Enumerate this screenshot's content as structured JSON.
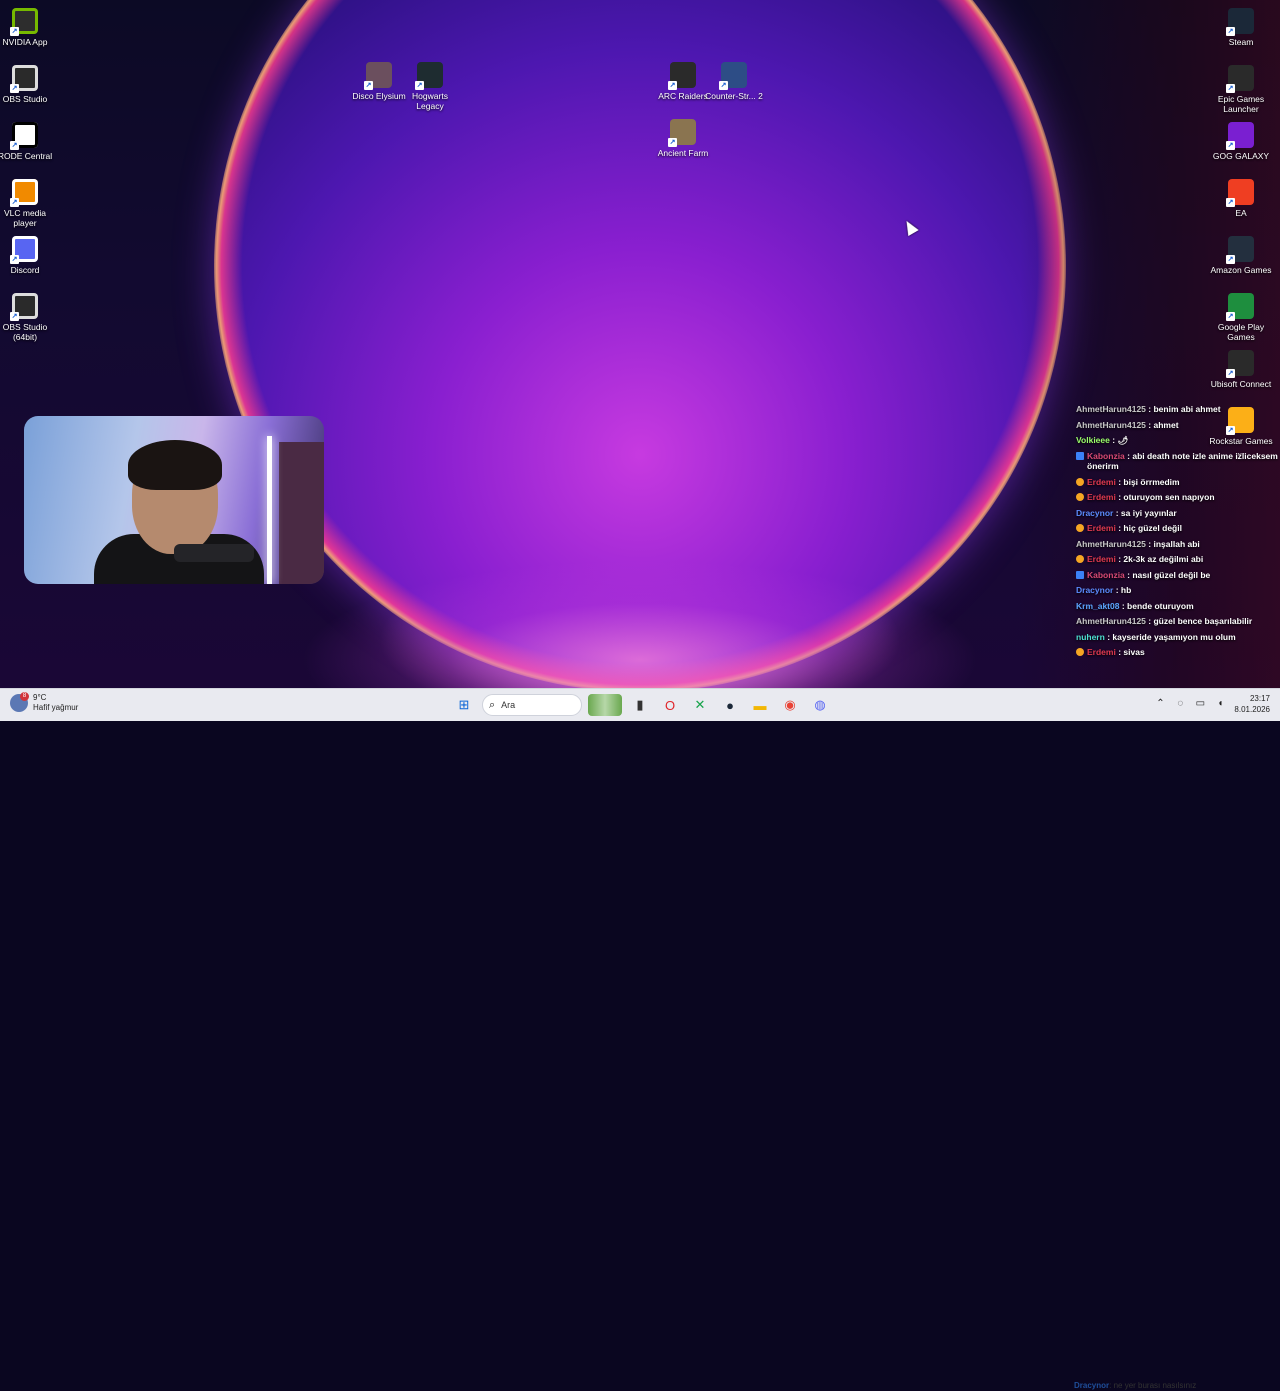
{
  "desktop": {
    "left_icons": [
      {
        "label": "NVIDIA App",
        "color": "#2d2d2d",
        "glyph": "nvidia",
        "accent": "#76b900"
      },
      {
        "label": "OBS Studio",
        "color": "#2a2a2a",
        "glyph": "obs",
        "accent": "#dddddd"
      },
      {
        "label": "RODE Central",
        "color": "#ffffff",
        "glyph": "rode",
        "accent": "#000000"
      },
      {
        "label": "VLC media player",
        "color": "#f18a00",
        "glyph": "vlc",
        "accent": "#ffffff"
      },
      {
        "label": "Discord",
        "color": "#5865f2",
        "glyph": "discord",
        "accent": "#ffffff"
      },
      {
        "label": "OBS Studio (64bit)",
        "color": "#2a2a2a",
        "glyph": "obs",
        "accent": "#dddddd"
      }
    ],
    "middle_icons": [
      {
        "label": "Disco Elysium",
        "color": "#6b4f5e",
        "glyph": "disco"
      },
      {
        "label": "Hogwarts Legacy",
        "color": "#1e2c30",
        "glyph": "hogwarts"
      },
      {
        "label": "ARC Raiders",
        "color": "#2a2a2a",
        "glyph": "arc"
      },
      {
        "label": "Counter-Str... 2",
        "color": "#2d4d86",
        "glyph": "cs2"
      },
      {
        "label": "Ancient Farm",
        "color": "#8a7450",
        "glyph": "farm"
      }
    ],
    "right_icons": [
      {
        "label": "Steam",
        "color": "#1b2838",
        "glyph": "steam"
      },
      {
        "label": "Epic Games Launcher",
        "color": "#2a2a2a",
        "glyph": "epic"
      },
      {
        "label": "GOG GALAXY",
        "color": "#7a1fd1",
        "glyph": "gog"
      },
      {
        "label": "EA",
        "color": "#ef3e22",
        "glyph": "ea"
      },
      {
        "label": "Amazon Games",
        "color": "#232f3e",
        "glyph": "amazon"
      },
      {
        "label": "Google Play Games",
        "color": "#1e8e3e",
        "glyph": "play"
      },
      {
        "label": "Ubisoft Connect",
        "color": "#2a2a2a",
        "glyph": "ubisoft"
      },
      {
        "label": "Rockstar Games ...",
        "color": "#fcaf17",
        "glyph": "rockstar"
      }
    ]
  },
  "chat": {
    "messages": [
      {
        "user": "AhmetHarun4125",
        "text": ": benim abi ahmet",
        "user_color": "#c8c8c8",
        "badge": "none"
      },
      {
        "user": "AhmetHarun4125",
        "text": ": ahmet",
        "user_color": "#c8c8c8",
        "badge": "none"
      },
      {
        "user": "Volkieee",
        "text": ": 🌶",
        "user_color": "#9cff6b",
        "badge": "none"
      },
      {
        "user": "Kabonzia",
        "text": ": abi death note izle anime izliceksem önerirm",
        "user_color": "#d94a74",
        "badge": "square"
      },
      {
        "user": "Erdemi",
        "text": ": bişi örrmedim",
        "user_color": "#e0394f",
        "badge": "round"
      },
      {
        "user": "Erdemi",
        "text": ": oturuyom sen napıyon",
        "user_color": "#e0394f",
        "badge": "round"
      },
      {
        "user": "Dracynor",
        "text": ": sa iyi yayınlar",
        "user_color": "#5c8cff",
        "badge": "none"
      },
      {
        "user": "Erdemi",
        "text": ": hiç güzel değil",
        "user_color": "#e0394f",
        "badge": "round"
      },
      {
        "user": "AhmetHarun4125",
        "text": ": inşallah abi",
        "user_color": "#c8c8c8",
        "badge": "none"
      },
      {
        "user": "Erdemi",
        "text": ": 2k-3k az değilmi abi",
        "user_color": "#e0394f",
        "badge": "round"
      },
      {
        "user": "Kabonzia",
        "text": ": nasıl güzel değil be",
        "user_color": "#d94a74",
        "badge": "square"
      },
      {
        "user": "Dracynor",
        "text": ": hb",
        "user_color": "#5c8cff",
        "badge": "none"
      },
      {
        "user": "Krm_akt08",
        "text": ": bende oturuyom",
        "user_color": "#5ca6ff",
        "badge": "none"
      },
      {
        "user": "AhmetHarun4125",
        "text": ": güzel bence başarılabilir",
        "user_color": "#c8c8c8",
        "badge": "none"
      },
      {
        "user": "nuhern",
        "text": ": kayseride yaşamıyon mu olum",
        "user_color": "#4de0d0",
        "badge": "none"
      },
      {
        "user": "Erdemi",
        "text": ": sivas",
        "user_color": "#e0394f",
        "badge": "round"
      }
    ],
    "overlay_user": "Dracynor",
    "overlay_text": ": ne yer burası nasılsınız"
  },
  "taskbar": {
    "weather_temp": "9°C",
    "weather_desc": "Hafif yağmur",
    "weather_badge": "8",
    "search_placeholder": "Ara",
    "apps": [
      {
        "name": "start-button",
        "symbol": "⊞",
        "color": "#0a64d6"
      },
      {
        "name": "task-view-button",
        "symbol": "▮",
        "color": "#333333"
      },
      {
        "name": "opera-button",
        "symbol": "O",
        "color": "#e0262b"
      },
      {
        "name": "xbox-button",
        "symbol": "✕",
        "color": "#16a34a"
      },
      {
        "name": "steam-taskbar-button",
        "symbol": "●",
        "color": "#1b2838"
      },
      {
        "name": "file-explorer-button",
        "symbol": "▬",
        "color": "#f2b705"
      },
      {
        "name": "chrome-button",
        "symbol": "◉",
        "color": "#e94235"
      },
      {
        "name": "discord-taskbar-button",
        "symbol": "◍",
        "color": "#5865f2"
      }
    ],
    "clock_time": "23:17",
    "clock_date": "8.01.2026"
  }
}
